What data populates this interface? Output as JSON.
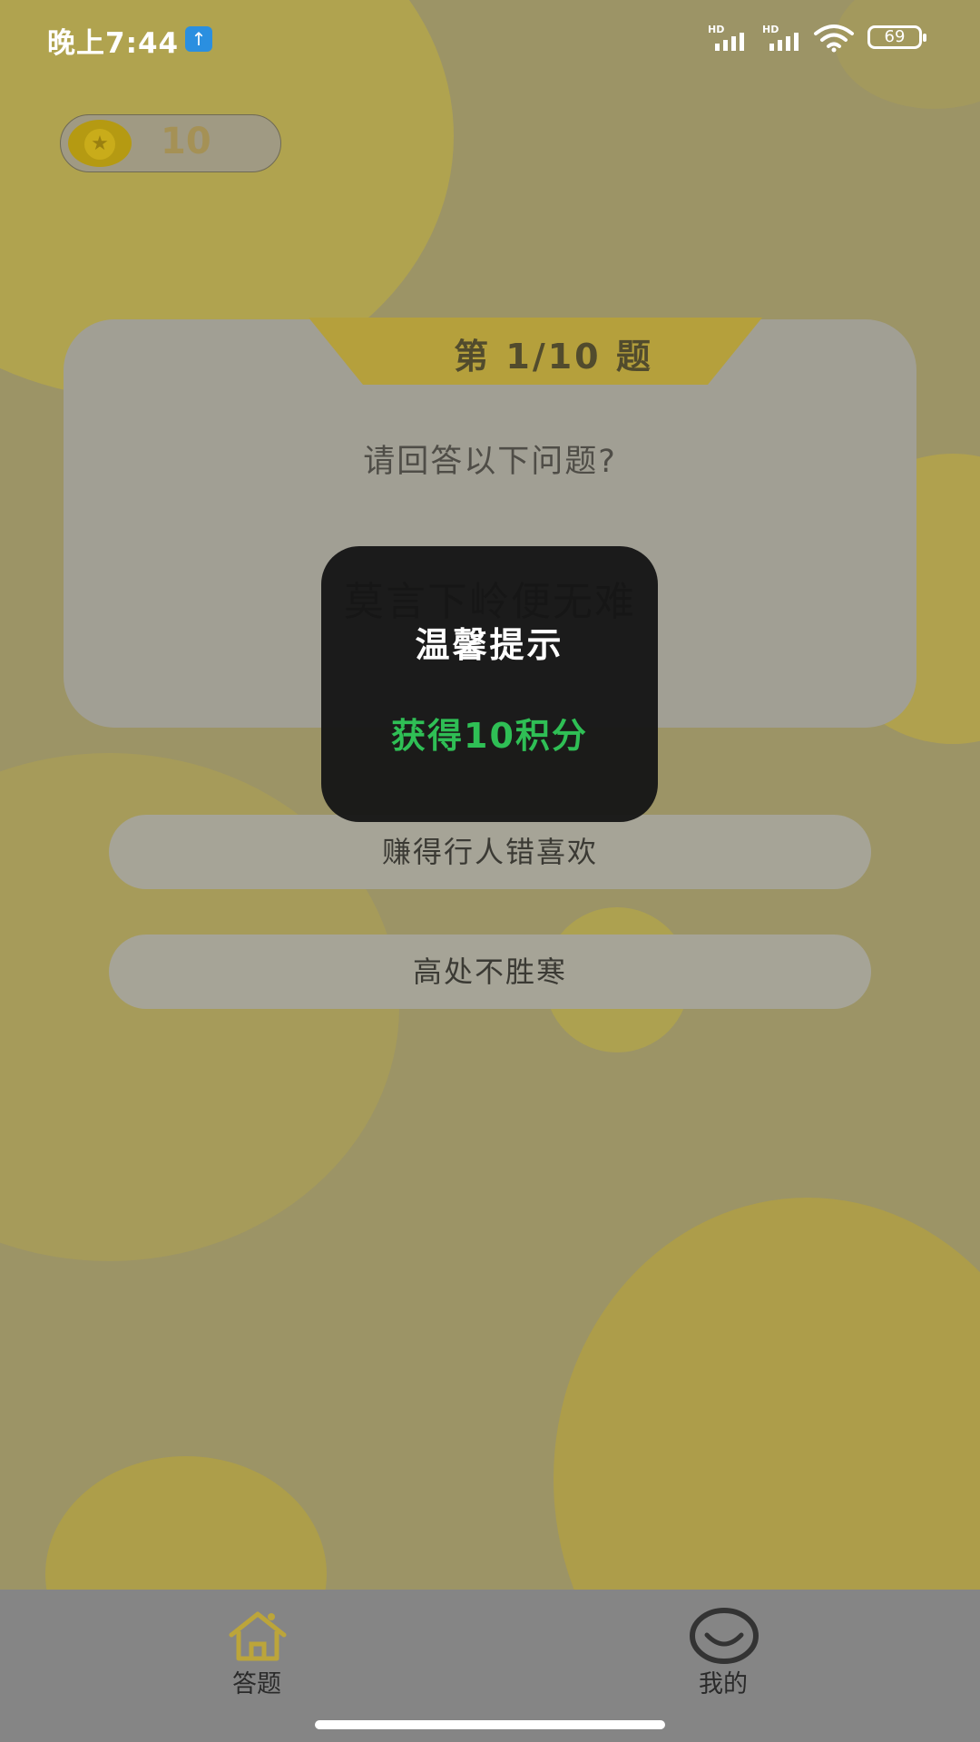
{
  "status_bar": {
    "time": "晚上7:44",
    "signal_label_1": "HD",
    "signal_label_2": "HD",
    "battery": "69"
  },
  "header": {
    "coin_count": "10"
  },
  "quiz": {
    "progress_label": "第 1/10 题",
    "question": "请回答以下问题?",
    "clue": "莫言下岭便无难",
    "options": [
      "赚得行人错喜欢",
      "高处不胜寒"
    ]
  },
  "toast": {
    "title": "温馨提示",
    "message": "获得10积分"
  },
  "tabbar": {
    "tab_quiz": "答题",
    "tab_me": "我的"
  },
  "colors": {
    "accent_gold": "#c9ac1a",
    "toast_green": "#2fbf55"
  }
}
